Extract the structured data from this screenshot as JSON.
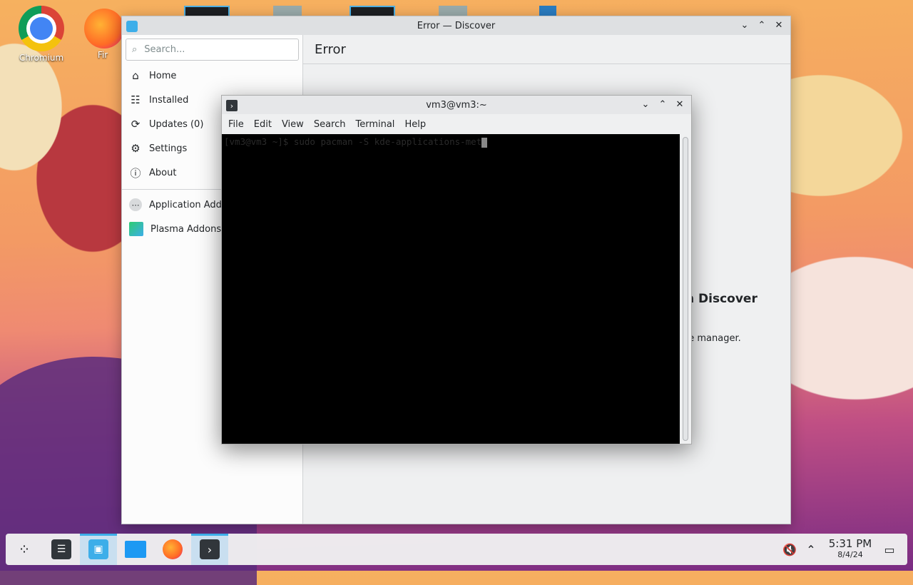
{
  "desktop": {
    "icons": [
      {
        "label": "Chromium"
      },
      {
        "label": "Fir"
      }
    ]
  },
  "discover": {
    "title": "Error — Discover",
    "search_placeholder": "Search...",
    "page_header": "Error",
    "nav": [
      {
        "label": "Home",
        "icon": "home-icon"
      },
      {
        "label": "Installed",
        "icon": "installed-icon"
      },
      {
        "label": "Updates (0)",
        "icon": "updates-icon"
      },
      {
        "label": "Settings",
        "icon": "settings-icon"
      },
      {
        "label": "About",
        "icon": "info-icon"
      }
    ],
    "addons": [
      {
        "label": "Application Addons",
        "icon": "more-dots-icon"
      },
      {
        "label": "Plasma Addons",
        "icon": "plasma-icon"
      }
    ],
    "error_title_fragment": "n Discover",
    "error_text_fragment": "ge manager."
  },
  "konsole": {
    "title": "vm3@vm3:~",
    "menu": [
      "File",
      "Edit",
      "View",
      "Search",
      "Terminal",
      "Help"
    ],
    "command_line": "[vm3@vm3 ~]$ sudo pacman -S kde-applications-met"
  },
  "taskbar": {
    "items": [
      {
        "name": "app-launcher",
        "icon": "launcher-icon"
      },
      {
        "name": "system-settings",
        "icon": "settings-panel-icon"
      },
      {
        "name": "discover",
        "icon": "discover-icon",
        "active": true
      },
      {
        "name": "file-manager",
        "icon": "folder-icon"
      },
      {
        "name": "firefox",
        "icon": "firefox-icon"
      },
      {
        "name": "konsole",
        "icon": "terminal-icon",
        "active": true
      }
    ],
    "time": "5:31 PM",
    "date": "8/4/24"
  },
  "colors": {
    "accent": "#3daee9",
    "terminal_bg": "#000000"
  }
}
